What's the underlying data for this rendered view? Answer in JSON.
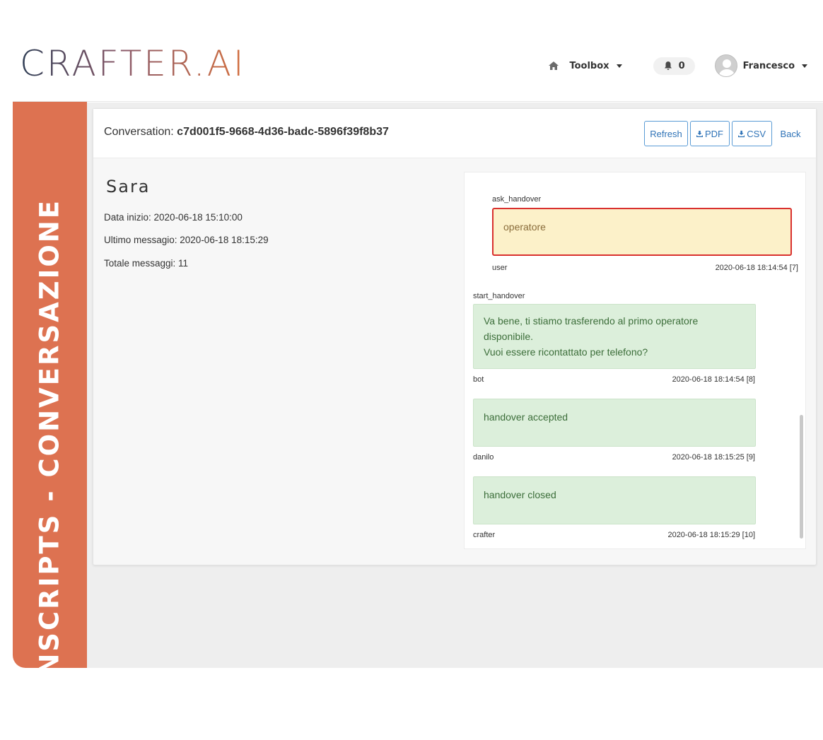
{
  "header": {
    "logo": "CRAFTER.AI",
    "nav": {
      "toolbox_label": "Toolbox",
      "notifications_count": "0",
      "user_name": "Francesco"
    }
  },
  "sidebar": {
    "title": "TRANSCRIPTS - CONVERSAZIONE"
  },
  "conversation": {
    "label": "Conversation:",
    "id": "c7d001f5-9668-4d36-badc-5896f39f8b37",
    "buttons": {
      "refresh": "Refresh",
      "pdf": "PDF",
      "csv": "CSV",
      "back": "Back"
    }
  },
  "contact": {
    "name": "Sara",
    "start_date": "Data inizio: 2020-06-18 15:10:00",
    "last_message": "Ultimo messagio: 2020-06-18 18:15:29",
    "total_messages": "Totale messaggi: 11"
  },
  "messages": [
    {
      "intent": "ask_handover",
      "text": "operatore",
      "sender": "user",
      "timestamp": "2020-06-18 18:14:54 [7]"
    },
    {
      "intent": "start_handover",
      "line1": "Va bene, ti stiamo trasferendo al primo operatore disponibile.",
      "line2": "Vuoi essere ricontattato per telefono?",
      "sender": "bot",
      "timestamp": "2020-06-18 18:14:54 [8]"
    },
    {
      "text": "handover accepted",
      "sender": "danilo",
      "timestamp": "2020-06-18 18:15:25 [9]"
    },
    {
      "text": "handover closed",
      "sender": "crafter",
      "timestamp": "2020-06-18 18:15:29 [10]"
    }
  ],
  "colors": {
    "sidebar": "#dd7251",
    "user_bubble_bg": "#fcf1c9",
    "user_bubble_border": "#d9302e",
    "bot_bubble_bg": "#dcefdb",
    "bot_text": "#3c6e3a",
    "button_blue": "#2f73b7"
  }
}
